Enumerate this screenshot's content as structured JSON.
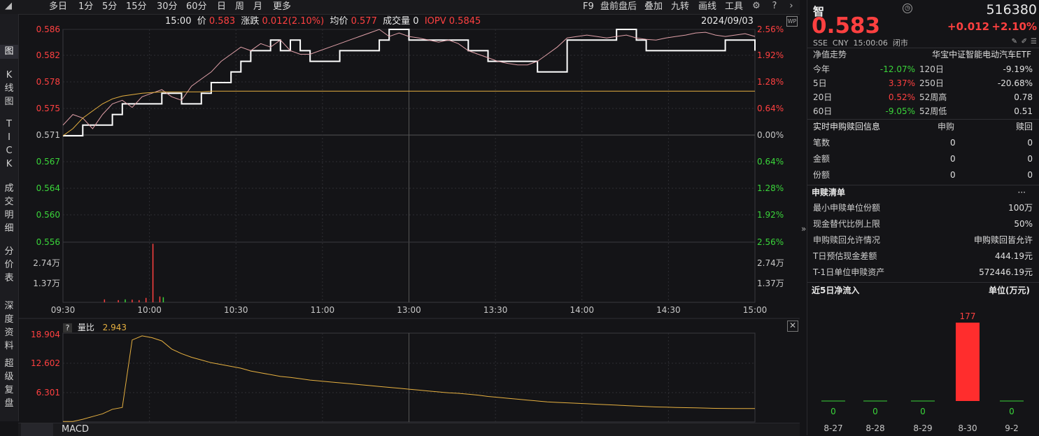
{
  "toolbar": {
    "left_items": [
      "多日",
      "1分",
      "5分",
      "15分",
      "30分",
      "60分",
      "日",
      "周",
      "月",
      "更多"
    ],
    "right_items": [
      "F9",
      "盘前盘后",
      "叠加",
      "九转",
      "画线",
      "工具"
    ]
  },
  "side_tabs": [
    {
      "label": "图",
      "active": true
    },
    {
      "label": "K线图"
    },
    {
      "label": "TICK"
    },
    {
      "label": "成交明细"
    },
    {
      "label": "分价表"
    },
    {
      "label": "深度资料"
    },
    {
      "label": "超级复盘"
    }
  ],
  "info": {
    "time": "15:00",
    "price_label": "价",
    "price": "0.583",
    "change_label": "涨跌",
    "change": "0.012(2.10%)",
    "avg_label": "均价",
    "avg": "0.577",
    "vol_label": "成交量",
    "vol": "0",
    "iopv_label": "IOPV",
    "iopv": "0.5845",
    "date": "2024/09/03"
  },
  "chart_data": [
    {
      "type": "line",
      "x_ticks": [
        "09:30",
        "10:00",
        "10:30",
        "11:00",
        "13:00",
        "13:30",
        "14:00",
        "14:30",
        "15:00"
      ],
      "y_left_ticks": [
        "0.586",
        "0.582",
        "0.578",
        "0.575",
        "0.571",
        "0.567",
        "0.564",
        "0.560",
        "0.556"
      ],
      "y_right_ticks": [
        "2.56%",
        "1.92%",
        "1.28%",
        "0.64%",
        "0.00%",
        "0.64%",
        "1.28%",
        "1.92%",
        "2.56%"
      ],
      "ylim": [
        0.556,
        0.586
      ],
      "prev_close": 0.571,
      "series": [
        {
          "color": "#ffffff",
          "values": [
            0.571,
            0.571,
            0.5725,
            0.5725,
            0.5725,
            0.574,
            0.5755,
            0.5755,
            0.5755,
            0.5755,
            0.577,
            0.577,
            0.5755,
            0.5755,
            0.577,
            0.5785,
            0.5785,
            0.58,
            0.5815,
            0.583,
            0.583,
            0.5845,
            0.583,
            0.5845,
            0.583,
            0.5815,
            0.5815,
            0.5815,
            0.583,
            0.583,
            0.583,
            0.583,
            0.5845,
            0.586,
            0.586,
            0.5845,
            0.5845,
            0.5845,
            0.5845,
            0.5845,
            0.5845,
            0.583,
            0.583,
            0.5815,
            0.5815,
            0.5815,
            0.5815,
            0.5815,
            0.58,
            0.58,
            0.58,
            0.5845,
            0.5845,
            0.5845,
            0.5845,
            0.5845,
            0.586,
            0.586,
            0.5845,
            0.583,
            0.583,
            0.583,
            0.583,
            0.583,
            0.583,
            0.583,
            0.583,
            0.5845,
            0.5845,
            0.5845,
            0.583
          ]
        },
        {
          "color": "#e0a0a8",
          "values": [
            0.5725,
            0.574,
            0.5735,
            0.572,
            0.574,
            0.5755,
            0.576,
            0.575,
            0.5765,
            0.577,
            0.5775,
            0.5765,
            0.576,
            0.578,
            0.579,
            0.58,
            0.5815,
            0.5825,
            0.5835,
            0.583,
            0.584,
            0.5835,
            0.5845,
            0.583,
            0.5825,
            0.5825,
            0.583,
            0.5835,
            0.584,
            0.5845,
            0.585,
            0.5855,
            0.586,
            0.585,
            0.5855,
            0.585,
            0.5848,
            0.5845,
            0.5842,
            0.5845,
            0.584,
            0.583,
            0.5825,
            0.582,
            0.5815,
            0.5812,
            0.581,
            0.581,
            0.5815,
            0.5825,
            0.5835,
            0.5848,
            0.585,
            0.5852,
            0.585,
            0.5848,
            0.585,
            0.5852,
            0.5848,
            0.5846,
            0.5845,
            0.5848,
            0.585,
            0.5852,
            0.5855,
            0.5856,
            0.5852,
            0.585,
            0.5852,
            0.5854,
            0.585
          ]
        },
        {
          "color": "#e6b040",
          "values": [
            0.571,
            0.572,
            0.5735,
            0.5745,
            0.5755,
            0.5762,
            0.5766,
            0.5768,
            0.577,
            0.5771,
            0.5772,
            0.5772,
            0.5772,
            0.5772,
            0.5772,
            0.5773,
            0.5773,
            0.5773,
            0.5773,
            0.5773,
            0.5773,
            0.5773,
            0.5773,
            0.5773,
            0.5773,
            0.5773,
            0.5773,
            0.5773,
            0.5773,
            0.5773,
            0.5773,
            0.5773,
            0.5773,
            0.5773,
            0.5773,
            0.5773,
            0.5773,
            0.5773,
            0.5773,
            0.5773,
            0.5773,
            0.5773,
            0.5773,
            0.5773,
            0.5773,
            0.5773,
            0.5773,
            0.5773,
            0.5773,
            0.5773,
            0.5773,
            0.5773,
            0.5773,
            0.5773,
            0.5773,
            0.5773,
            0.5773,
            0.5773,
            0.5773,
            0.5773,
            0.5773,
            0.5773,
            0.5773,
            0.5773,
            0.5773,
            0.5773,
            0.5773,
            0.5773,
            0.5773,
            0.5773,
            0.5773
          ]
        }
      ]
    },
    {
      "type": "bar",
      "y_ticks": [
        "2.74万",
        "1.37万"
      ],
      "ylim": [
        0,
        4.11
      ],
      "bars": [
        {
          "t": 0.12,
          "v": 0.3,
          "color": "#ff4040"
        },
        {
          "t": 0.13,
          "v": 4.0,
          "color": "#ff4040"
        },
        {
          "t": 0.14,
          "v": 0.4,
          "color": "#ff4040"
        },
        {
          "t": 0.145,
          "v": 0.35,
          "color": "#3ad53a"
        },
        {
          "t": 0.06,
          "v": 0.2,
          "color": "#ff4040"
        },
        {
          "t": 0.08,
          "v": 0.15,
          "color": "#ff4040"
        },
        {
          "t": 0.09,
          "v": 0.2,
          "color": "#3ad53a"
        },
        {
          "t": 0.1,
          "v": 0.18,
          "color": "#ff4040"
        },
        {
          "t": 0.11,
          "v": 0.15,
          "color": "#ff4040"
        }
      ]
    },
    {
      "type": "line",
      "name": "量比",
      "value": "2.943",
      "y_ticks": [
        "18.904",
        "12.602",
        "6.301"
      ],
      "ylim": [
        0,
        19.5
      ],
      "values": [
        0.1,
        0.1,
        0.6,
        1.2,
        1.8,
        2.8,
        3.2,
        18.0,
        18.9,
        18.5,
        17.8,
        16.0,
        15.0,
        14.2,
        13.6,
        13.0,
        12.6,
        12.2,
        11.8,
        11.2,
        10.8,
        10.4,
        10.0,
        9.8,
        9.5,
        9.2,
        9.0,
        8.8,
        8.6,
        8.4,
        8.2,
        8.0,
        7.8,
        7.6,
        7.4,
        7.2,
        7.0,
        6.8,
        6.6,
        6.4,
        6.3,
        6.1,
        5.9,
        5.6,
        5.4,
        5.2,
        5.0,
        4.8,
        4.6,
        4.4,
        4.3,
        4.2,
        4.1,
        4.0,
        3.9,
        3.8,
        3.7,
        3.6,
        3.5,
        3.4,
        3.3,
        3.25,
        3.2,
        3.15,
        3.1,
        3.05,
        3.0,
        2.98,
        2.96,
        2.95,
        2.943
      ]
    }
  ],
  "sub_chart": {
    "help": "?",
    "name": "量比",
    "value": "2.943"
  },
  "bottom_tabs": [
    "MACD"
  ],
  "panel": {
    "name_char": "智",
    "code": "516380",
    "price": "0.583",
    "change": "+0.012",
    "pct": "+2.10%",
    "meta": "SSE  CNY  15:00:06  闭市",
    "nav_title": "净值走势",
    "fund_name": "华宝中证智能电动汽车ETF",
    "perf": [
      {
        "l1": "今年",
        "v1": "-12.07%",
        "c1": "green",
        "l2": "120日",
        "v2": "-9.19%",
        "c2": "green"
      },
      {
        "l1": "5日",
        "v1": "3.37%",
        "c1": "red",
        "l2": "250日",
        "v2": "-20.68%",
        "c2": "green"
      },
      {
        "l1": "20日",
        "v1": "0.52%",
        "c1": "red",
        "l2": "52周高",
        "v2": "0.78",
        "c2": "white"
      },
      {
        "l1": "60日",
        "v1": "-9.05%",
        "c1": "green",
        "l2": "52周低",
        "v2": "0.51",
        "c2": "white"
      }
    ],
    "sub_title": "实时申购赎回信息",
    "sub_col1": "申购",
    "sub_col2": "赎回",
    "sub_rows": [
      {
        "label": "笔数",
        "a": "0",
        "b": "0"
      },
      {
        "label": "金额",
        "a": "0",
        "b": "0"
      },
      {
        "label": "份额",
        "a": "0",
        "b": "0"
      }
    ],
    "list_title": "申赎清单",
    "list_more": "···",
    "list_rows": [
      {
        "label": "最小申赎单位份额",
        "value": "100万"
      },
      {
        "label": "现金替代比例上限",
        "value": "50%"
      },
      {
        "label": "申购赎回允许情况",
        "value": "申购赎回皆允许"
      },
      {
        "label": "T日预估现金差额",
        "value": "444.19元"
      },
      {
        "label": "T-1日单位申赎资产",
        "value": "572446.19元"
      }
    ],
    "flow_title": "近5日净流入",
    "flow_unit": "单位(万元)",
    "flow": [
      {
        "date": "8-27",
        "value": 0
      },
      {
        "date": "8-28",
        "value": 0
      },
      {
        "date": "8-29",
        "value": 0
      },
      {
        "date": "8-30",
        "value": 177
      },
      {
        "date": "9-2",
        "value": 0
      }
    ]
  }
}
